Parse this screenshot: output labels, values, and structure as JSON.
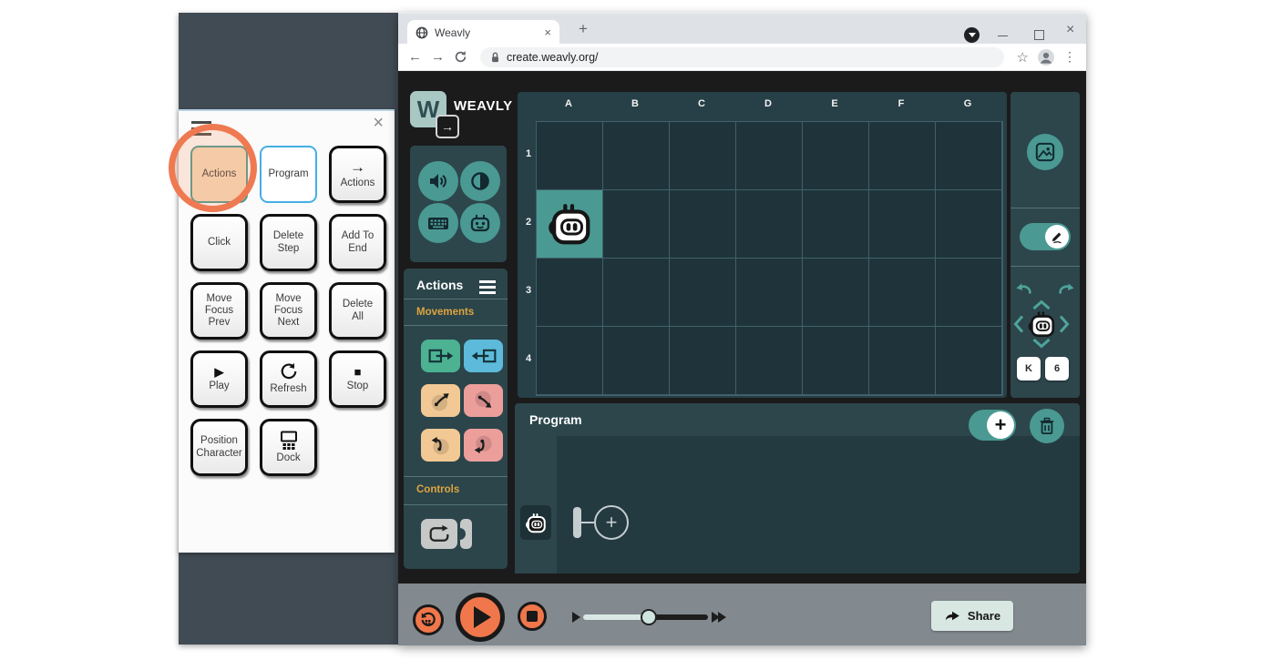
{
  "glyphs": {
    "close": "×",
    "plus": "+",
    "arrow_right": "→",
    "arrow_left": "←",
    "play": "▶",
    "stop": "■",
    "star": "☆",
    "menu_dots": "⋮"
  },
  "shortcuts_panel": {
    "buttons": [
      {
        "label": "Actions"
      },
      {
        "label": "Program"
      },
      {
        "label": "Actions"
      },
      {
        "label": "Click"
      },
      {
        "label": "Delete Step"
      },
      {
        "label": "Add To End"
      },
      {
        "label": "Move Focus Prev"
      },
      {
        "label": "Move Focus Next"
      },
      {
        "label": "Delete All"
      },
      {
        "label": "Play"
      },
      {
        "label": "Refresh"
      },
      {
        "label": "Stop"
      },
      {
        "label": "Position Character"
      },
      {
        "label": "Dock"
      }
    ]
  },
  "browser": {
    "tab_title": "Weavly",
    "url": "create.weavly.org/"
  },
  "app": {
    "logo": {
      "letter": "W",
      "text": "WEAVLY"
    },
    "actions_panel": {
      "title": "Actions",
      "movements_label": "Movements",
      "controls_label": "Controls"
    },
    "scene": {
      "columns": [
        "A",
        "B",
        "C",
        "D",
        "E",
        "F",
        "G"
      ],
      "rows": [
        "1",
        "2",
        "3",
        "4"
      ],
      "character_cell": "A2"
    },
    "right_panel": {
      "keys": [
        "K",
        "6"
      ]
    },
    "program": {
      "title": "Program"
    },
    "bottom_bar": {
      "share_label": "Share"
    }
  },
  "colors": {
    "teal_accent": "#4a9992",
    "panel_teal_dark": "#2c464c",
    "scene_bg": "#273f46",
    "cell_bg": "#1f343a",
    "app_bg": "#1b1b1b",
    "highlight_orange": "#ef7a52",
    "control_orange": "#f0774b",
    "movement_green": "#4cb292",
    "movement_blue": "#5dbada",
    "movement_yellow": "#f2c994",
    "movement_pink": "#ec9e9b",
    "section_label_orange": "#dfa43e",
    "share_bg": "#d8e7e2",
    "bottom_bar_gray": "#82898f",
    "left_window_gray": "#414b54"
  }
}
